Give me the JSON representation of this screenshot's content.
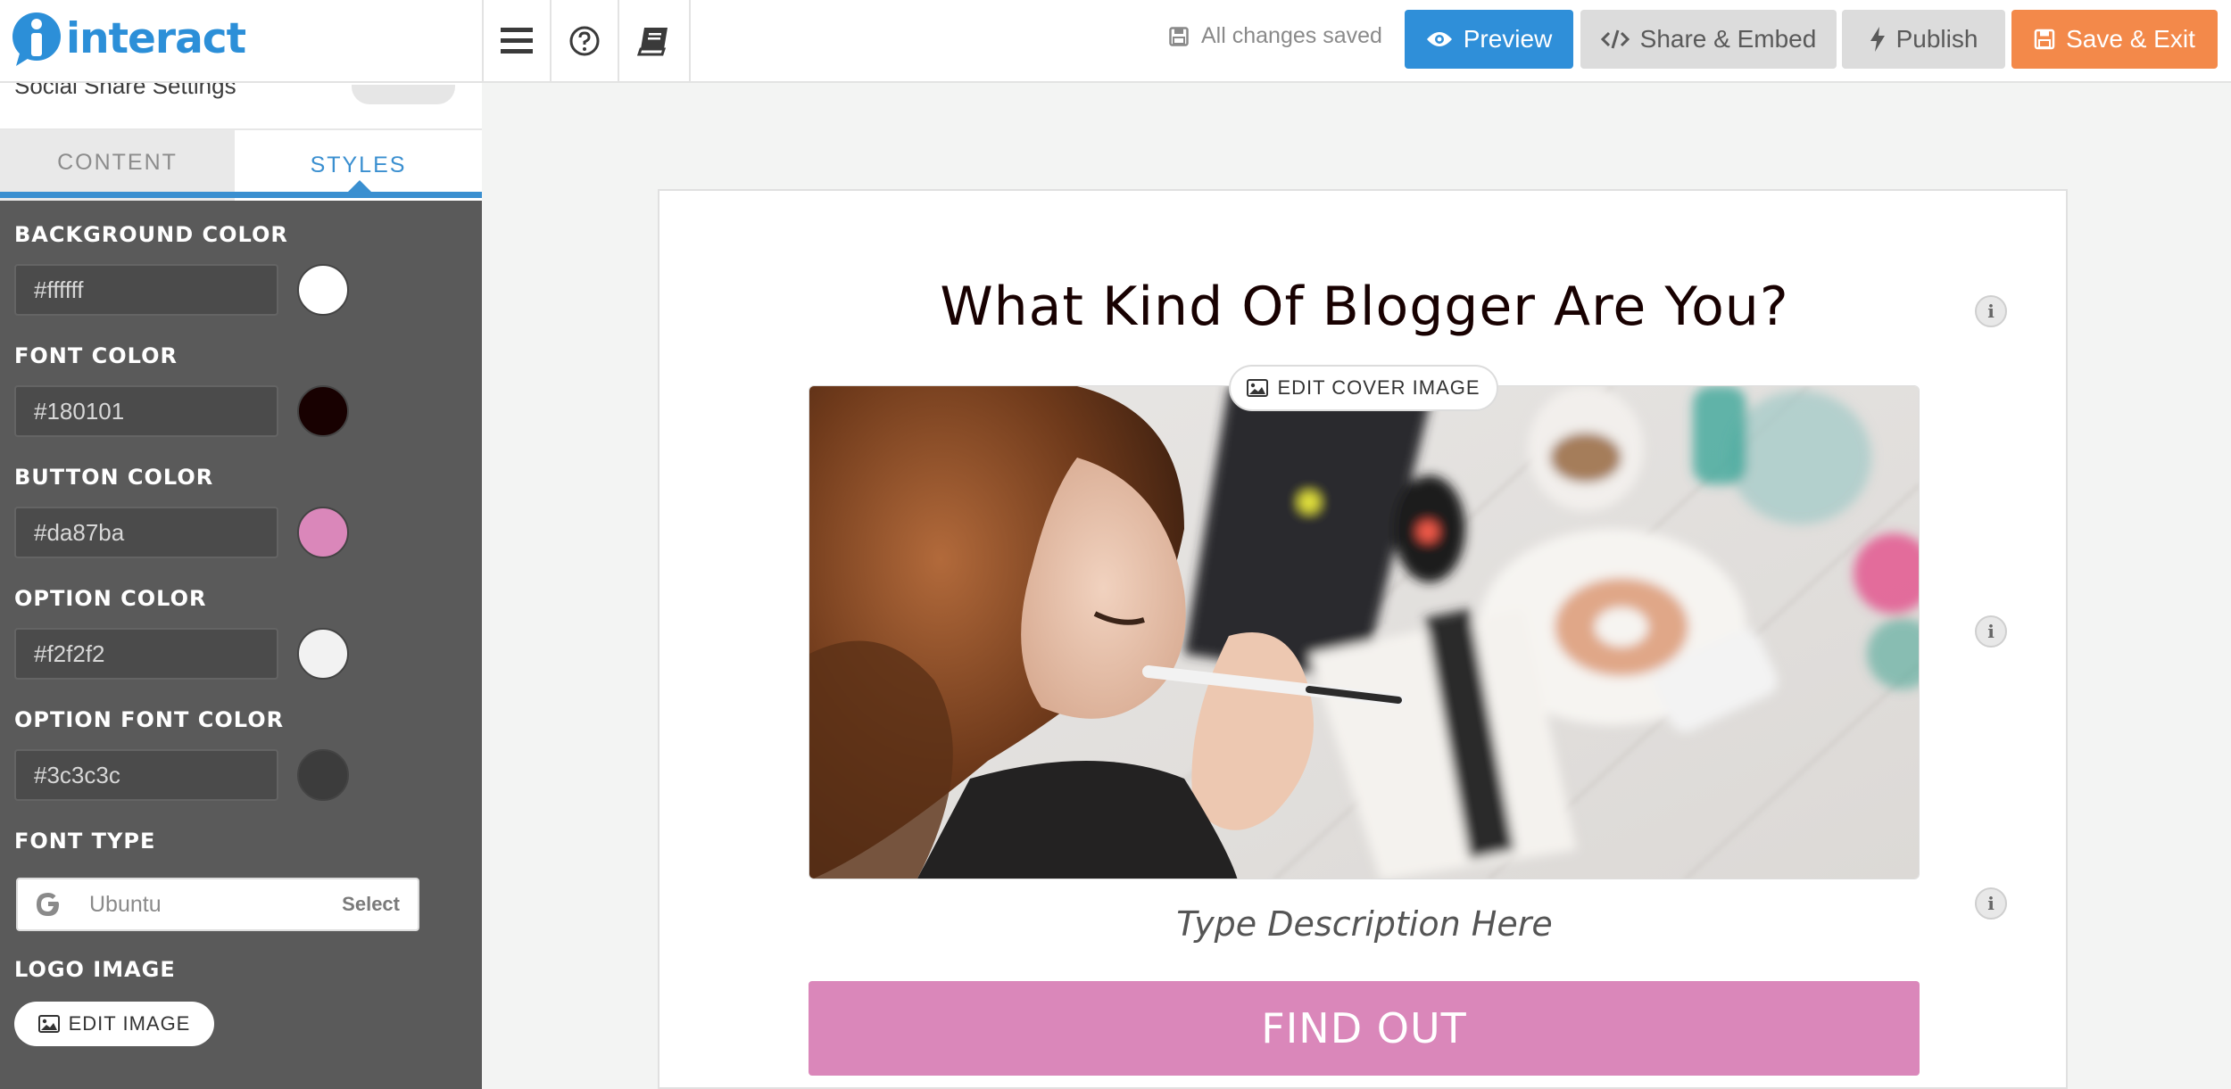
{
  "app": {
    "logo_text": "interact"
  },
  "toolbar": {
    "menu_icon": "hamburger-menu-icon",
    "help_icon": "question-circle-icon",
    "book_icon": "book-icon",
    "save_status": "All changes saved",
    "preview_label": "Preview",
    "share_label": "Share & Embed",
    "publish_label": "Publish",
    "save_exit_label": "Save & Exit",
    "colors": {
      "preview": "#2f8fd9",
      "save_exit": "#f3894a",
      "neutral": "#dcdcdc"
    }
  },
  "sidebar": {
    "social_share_label": "Social Share Settings",
    "tabs": [
      {
        "label": "CONTENT",
        "active": false
      },
      {
        "label": "STYLES",
        "active": true
      }
    ],
    "styles": {
      "background_color": {
        "label": "BACKGROUND COLOR",
        "value": "#ffffff"
      },
      "font_color": {
        "label": "FONT COLOR",
        "value": "#180101"
      },
      "button_color": {
        "label": "BUTTON COLOR",
        "value": "#da87ba"
      },
      "option_color": {
        "label": "OPTION COLOR",
        "value": "#f2f2f2"
      },
      "option_font_color": {
        "label": "OPTION FONT COLOR",
        "value": "#3c3c3c"
      },
      "font_type": {
        "label": "FONT TYPE",
        "value": "Ubuntu",
        "select_label": "Select"
      },
      "logo_image": {
        "label": "LOGO IMAGE",
        "button_label": "EDIT IMAGE"
      }
    }
  },
  "canvas": {
    "title": "What Kind Of Blogger Are You?",
    "edit_cover_label": "EDIT COVER IMAGE",
    "description_placeholder": "Type Description Here",
    "cta_label": "FIND OUT"
  }
}
